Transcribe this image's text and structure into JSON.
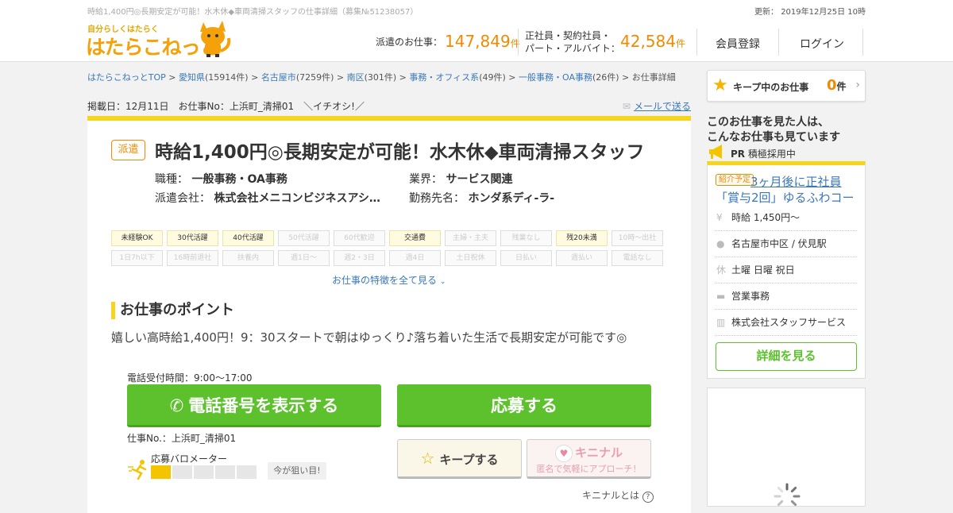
{
  "header": {
    "top_text": "時給1,400円◎長期安定が可能！水木休◆車両清掃スタッフの仕事詳細（募集№51238057）",
    "updated": "更新： 2019年12月25日 10時",
    "logo_sub": "自分らしくはたらく",
    "logo_main": "はたらこねっと",
    "stat1_label": "派遣のお仕事：",
    "stat1_num": "147,849",
    "stat1_unit": "件",
    "stat2_label1": "正社員・契約社員・",
    "stat2_label2": "パート・アルバイト：",
    "stat2_num": "42,584",
    "stat2_unit": "件",
    "register": "会員登録",
    "login": "ログイン"
  },
  "breadcrumb": [
    {
      "text": "はたらこねっとTOP",
      "link": true
    },
    {
      "text": " > ",
      "link": false
    },
    {
      "text": "愛知県",
      "link": true
    },
    {
      "text": "(15914件) > ",
      "link": false
    },
    {
      "text": "名古屋市",
      "link": true
    },
    {
      "text": "(7259件) > ",
      "link": false
    },
    {
      "text": "南区",
      "link": true
    },
    {
      "text": "(301件) > ",
      "link": false
    },
    {
      "text": "事務・オフィス系",
      "link": true
    },
    {
      "text": "(49件) > ",
      "link": false
    },
    {
      "text": "一般事務・OA事務",
      "link": true
    },
    {
      "text": "(26件) > お仕事詳細",
      "link": false
    }
  ],
  "meta": {
    "posted": "掲載日：12月11日　お仕事No：上浜町_清掃01　＼イチオシ!／",
    "mail": "メールで送る"
  },
  "job": {
    "badge": "派遣",
    "title": "時給1,400円◎長期安定が可能！水木休◆車両清掃スタッフ",
    "type_label": "職種：",
    "type_value": "一般事務・OA事務",
    "industry_label": "業界：",
    "industry_value": "サービス関連",
    "agency_label": "派遣会社：",
    "agency_value": "株式会社メニコンビジネスアシ…",
    "workplace_label": "勤務先名：",
    "workplace_value": "ホンダ系ディ-ラ-"
  },
  "tags": [
    {
      "label": "未経験OK",
      "on": true
    },
    {
      "label": "30代活躍",
      "on": true
    },
    {
      "label": "40代活躍",
      "on": true
    },
    {
      "label": "50代活躍",
      "on": false
    },
    {
      "label": "60代歓迎",
      "on": false
    },
    {
      "label": "交通費",
      "on": true
    },
    {
      "label": "主婦・主夫",
      "on": false
    },
    {
      "label": "残業なし",
      "on": false
    },
    {
      "label": "残20未満",
      "on": true
    },
    {
      "label": "10時～出社",
      "on": false
    },
    {
      "label": "1日7h以下",
      "on": false
    },
    {
      "label": "16時前退社",
      "on": false
    },
    {
      "label": "扶養内",
      "on": false
    },
    {
      "label": "週1日～",
      "on": false
    },
    {
      "label": "週2・3日",
      "on": false
    },
    {
      "label": "週4日",
      "on": false
    },
    {
      "label": "土日祝休",
      "on": false
    },
    {
      "label": "日払い",
      "on": false
    },
    {
      "label": "週払い",
      "on": false
    },
    {
      "label": "電話なし",
      "on": false
    }
  ],
  "see_all": "お仕事の特徴を全て見る",
  "point": {
    "heading": "お仕事のポイント",
    "text": "嬉しい高時給1,400円！9：30スタートで朝はゆっくり♪落ち着いた生活で長期安定が可能です◎"
  },
  "apply": {
    "tel_hours": "電話受付時間：9:00～17:00",
    "tel_button": "電話番号を表示する",
    "apply_button": "応募する",
    "job_no": "仕事No.：上浜町_清掃01",
    "meter_label": "応募バロメーター",
    "meter_level": 1,
    "meter_max": 5,
    "now_text": "今が狙い目!",
    "keep_button": "キープする",
    "kininal_title": "キニナル",
    "kininal_sub": "匿名で気軽にアプローチ！",
    "kininal_what": "キニナルとは"
  },
  "sidebar": {
    "keep_label": "キープ中のお仕事",
    "keep_count": "0",
    "keep_unit": "件",
    "also_line1": "このお仕事を見た人は、",
    "also_line2": "こんなお仕事も見ています",
    "pr": "PR",
    "pr_text": "積極採用中",
    "rec_badge": "紹介予定",
    "rec_title_1": "3ヶ月後に正社員",
    "rec_title_2": "「賞与2回」ゆるふわコー",
    "rows": [
      {
        "icon": "yen-icon",
        "glyph": "¥",
        "text": "時給 1,450円～"
      },
      {
        "icon": "location-pin-icon",
        "glyph": "●",
        "text": "名古屋市中区 / 伏見駅"
      },
      {
        "icon": "holiday-icon",
        "glyph": "休",
        "text": "土曜 日曜 祝日"
      },
      {
        "icon": "briefcase-icon",
        "glyph": "▬",
        "text": "営業事務"
      },
      {
        "icon": "building-icon",
        "glyph": "▥",
        "text": "株式会社スタッフサービス"
      }
    ],
    "detail_button": "詳細を見る"
  }
}
